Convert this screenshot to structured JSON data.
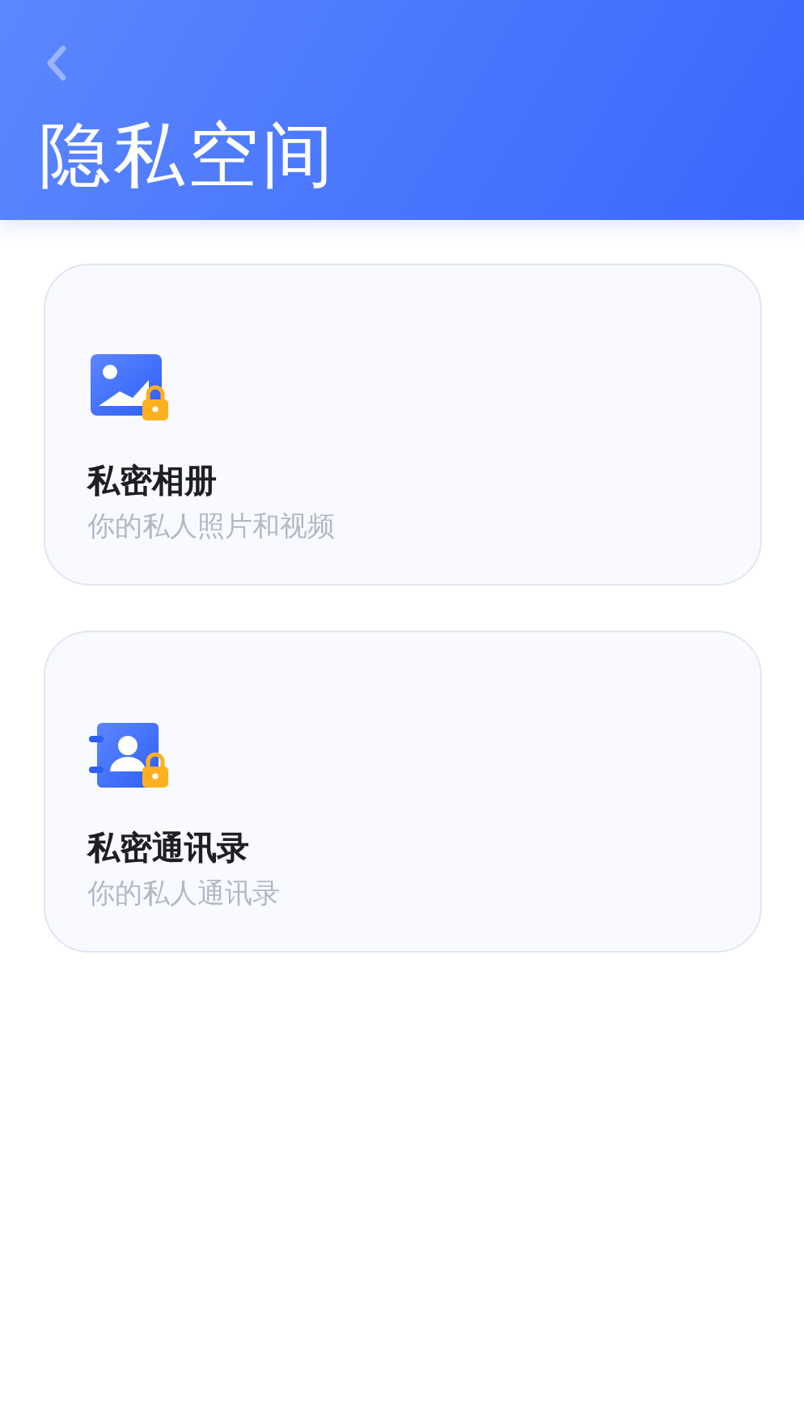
{
  "header": {
    "title": "隐私空间"
  },
  "cards": [
    {
      "kind": "album",
      "title": "私密相册",
      "subtitle": "你的私人照片和视频"
    },
    {
      "kind": "contacts",
      "title": "私密通讯录",
      "subtitle": "你的私人通讯录"
    }
  ]
}
